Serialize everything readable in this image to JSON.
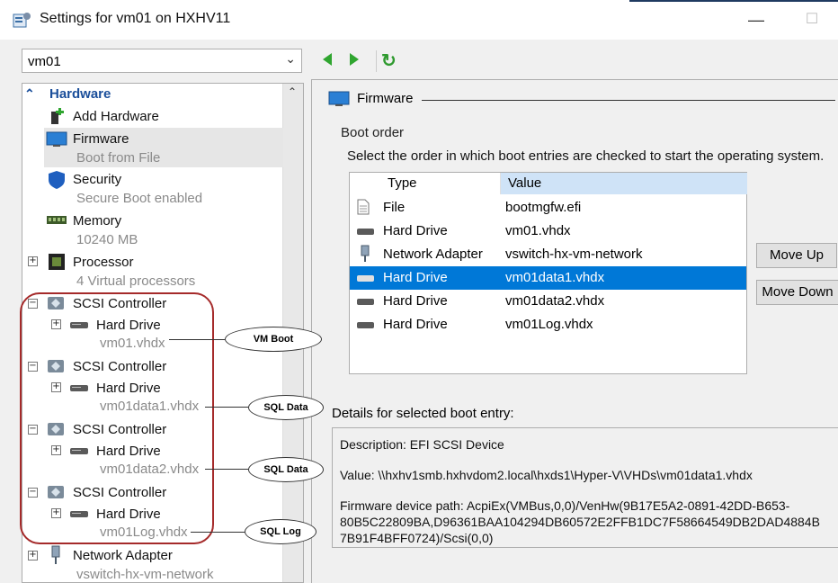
{
  "window": {
    "title": "Settings for vm01 on HXHV11",
    "minimize_glyph": "—",
    "maximize_glyph": "☐"
  },
  "vm_selector": {
    "value": "vm01"
  },
  "toolbar": {
    "icons": [
      "back-arrow-icon",
      "forward-arrow-icon",
      "refresh-icon"
    ]
  },
  "tree": {
    "hardware_header": "Hardware",
    "add_hardware": "Add Hardware",
    "firmware": {
      "label": "Firmware",
      "sub": "Boot from File"
    },
    "security": {
      "label": "Security",
      "sub": "Secure Boot enabled"
    },
    "memory": {
      "label": "Memory",
      "sub": "10240 MB"
    },
    "processor": {
      "label": "Processor",
      "sub": "4 Virtual processors"
    },
    "scsi": [
      {
        "label": "SCSI Controller",
        "drive": "Hard Drive",
        "file": "vm01.vhdx"
      },
      {
        "label": "SCSI Controller",
        "drive": "Hard Drive",
        "file": "vm01data1.vhdx"
      },
      {
        "label": "SCSI Controller",
        "drive": "Hard Drive",
        "file": "vm01data2.vhdx"
      },
      {
        "label": "SCSI Controller",
        "drive": "Hard Drive",
        "file": "vm01Log.vhdx"
      }
    ],
    "network": {
      "label": "Network Adapter",
      "sub": "vswitch-hx-vm-network"
    }
  },
  "firmware_panel": {
    "header": "Firmware",
    "boot_order_label": "Boot order",
    "boot_order_desc": "Select the order in which boot entries are checked to start the operating system.",
    "columns": {
      "type": "Type",
      "value": "Value"
    },
    "rows": [
      {
        "type": "File",
        "value": "bootmgfw.efi",
        "icon": "file-icon"
      },
      {
        "type": "Hard Drive",
        "value": "vm01.vhdx",
        "icon": "hard-drive-icon"
      },
      {
        "type": "Network Adapter",
        "value": "vswitch-hx-vm-network",
        "icon": "network-adapter-icon"
      },
      {
        "type": "Hard Drive",
        "value": "vm01data1.vhdx",
        "icon": "hard-drive-icon",
        "selected": true
      },
      {
        "type": "Hard Drive",
        "value": "vm01data2.vhdx",
        "icon": "hard-drive-icon"
      },
      {
        "type": "Hard Drive",
        "value": "vm01Log.vhdx",
        "icon": "hard-drive-icon"
      }
    ],
    "move_up": "Move Up",
    "move_down": "Move Down",
    "details_label": "Details for selected boot entry:",
    "details": {
      "description": "Description: EFI SCSI Device",
      "value": "Value: \\\\hxhv1smb.hxhvdom2.local\\hxds1\\Hyper-V\\VHDs\\vm01data1.vhdx",
      "path_line1": "Firmware device path: AcpiEx(VMBus,0,0)/VenHw(9B17E5A2-0891-42DD-B653-",
      "path_line2": "80B5C22809BA,D96361BAA104294DB60572E2FFB1DC7F58664549DB2DAD4884B",
      "path_line3": "7B91F4BFF0724)/Scsi(0,0)"
    }
  },
  "callouts": [
    "VM Boot",
    "SQL Data",
    "SQL Data",
    "SQL Log"
  ],
  "colors": {
    "selection": "#0078d7",
    "callout_border": "#a52a2a",
    "hardware_header": "#1a4e9a"
  }
}
